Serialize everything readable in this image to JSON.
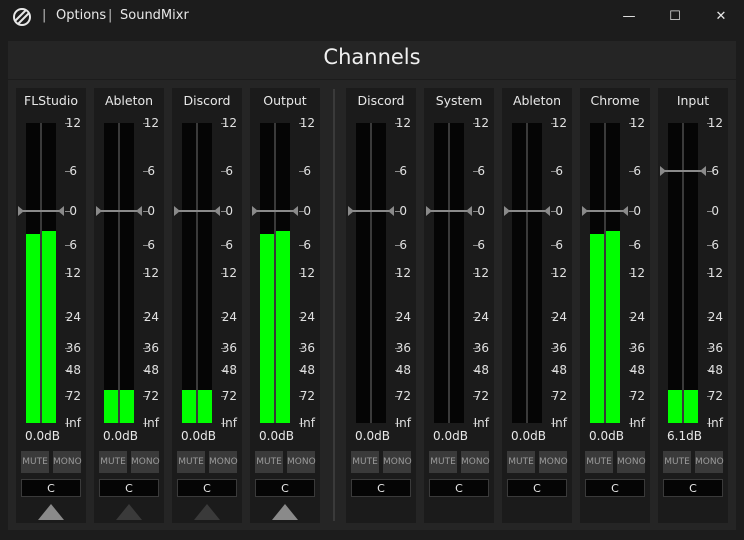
{
  "window": {
    "app_name": "SoundMixr",
    "options_label": "Options",
    "separator": "|",
    "minimize_glyph": "—",
    "maximize_glyph": "☐",
    "close_glyph": "✕"
  },
  "panel": {
    "title": "Channels"
  },
  "scale": [
    "12",
    "6",
    "0",
    "6",
    "12",
    "24",
    "36",
    "48",
    "72",
    "Inf"
  ],
  "buttons": {
    "mute": "MUTE",
    "mono": "MONO"
  },
  "colors": {
    "meter": "#00ff00",
    "background": "#1c1c1c",
    "strip": "#1b1b1b",
    "button": "#3a3a3a"
  },
  "channels": [
    {
      "name": "FLStudio",
      "group": "output",
      "level_left": 0.63,
      "level_right": 0.64,
      "fader_db": 0,
      "readout": "0.0dB",
      "pan": "C",
      "sidebar_indicator": "active"
    },
    {
      "name": "Ableton",
      "group": "output",
      "level_left": 0.11,
      "level_right": 0.11,
      "fader_db": 0,
      "readout": "0.0dB",
      "pan": "C",
      "sidebar_indicator": "inactive"
    },
    {
      "name": "Discord",
      "group": "output",
      "level_left": 0.11,
      "level_right": 0.11,
      "fader_db": 0,
      "readout": "0.0dB",
      "pan": "C",
      "sidebar_indicator": "inactive"
    },
    {
      "name": "Output",
      "group": "output",
      "level_left": 0.63,
      "level_right": 0.64,
      "fader_db": 0,
      "readout": "0.0dB",
      "pan": "C",
      "sidebar_indicator": "active"
    },
    {
      "name": "Discord",
      "group": "input",
      "level_left": 0,
      "level_right": 0,
      "fader_db": 0,
      "readout": "0.0dB",
      "pan": "C"
    },
    {
      "name": "System",
      "group": "input",
      "level_left": 0,
      "level_right": 0,
      "fader_db": 0,
      "readout": "0.0dB",
      "pan": "C"
    },
    {
      "name": "Ableton",
      "group": "input",
      "level_left": 0,
      "level_right": 0,
      "fader_db": 0,
      "readout": "0.0dB",
      "pan": "C"
    },
    {
      "name": "Chrome",
      "group": "input",
      "level_left": 0.63,
      "level_right": 0.64,
      "fader_db": 0,
      "readout": "0.0dB",
      "pan": "C"
    },
    {
      "name": "Input",
      "group": "input",
      "level_left": 0.11,
      "level_right": 0.11,
      "fader_db": 6.1,
      "readout": "6.1dB",
      "pan": "C"
    }
  ]
}
